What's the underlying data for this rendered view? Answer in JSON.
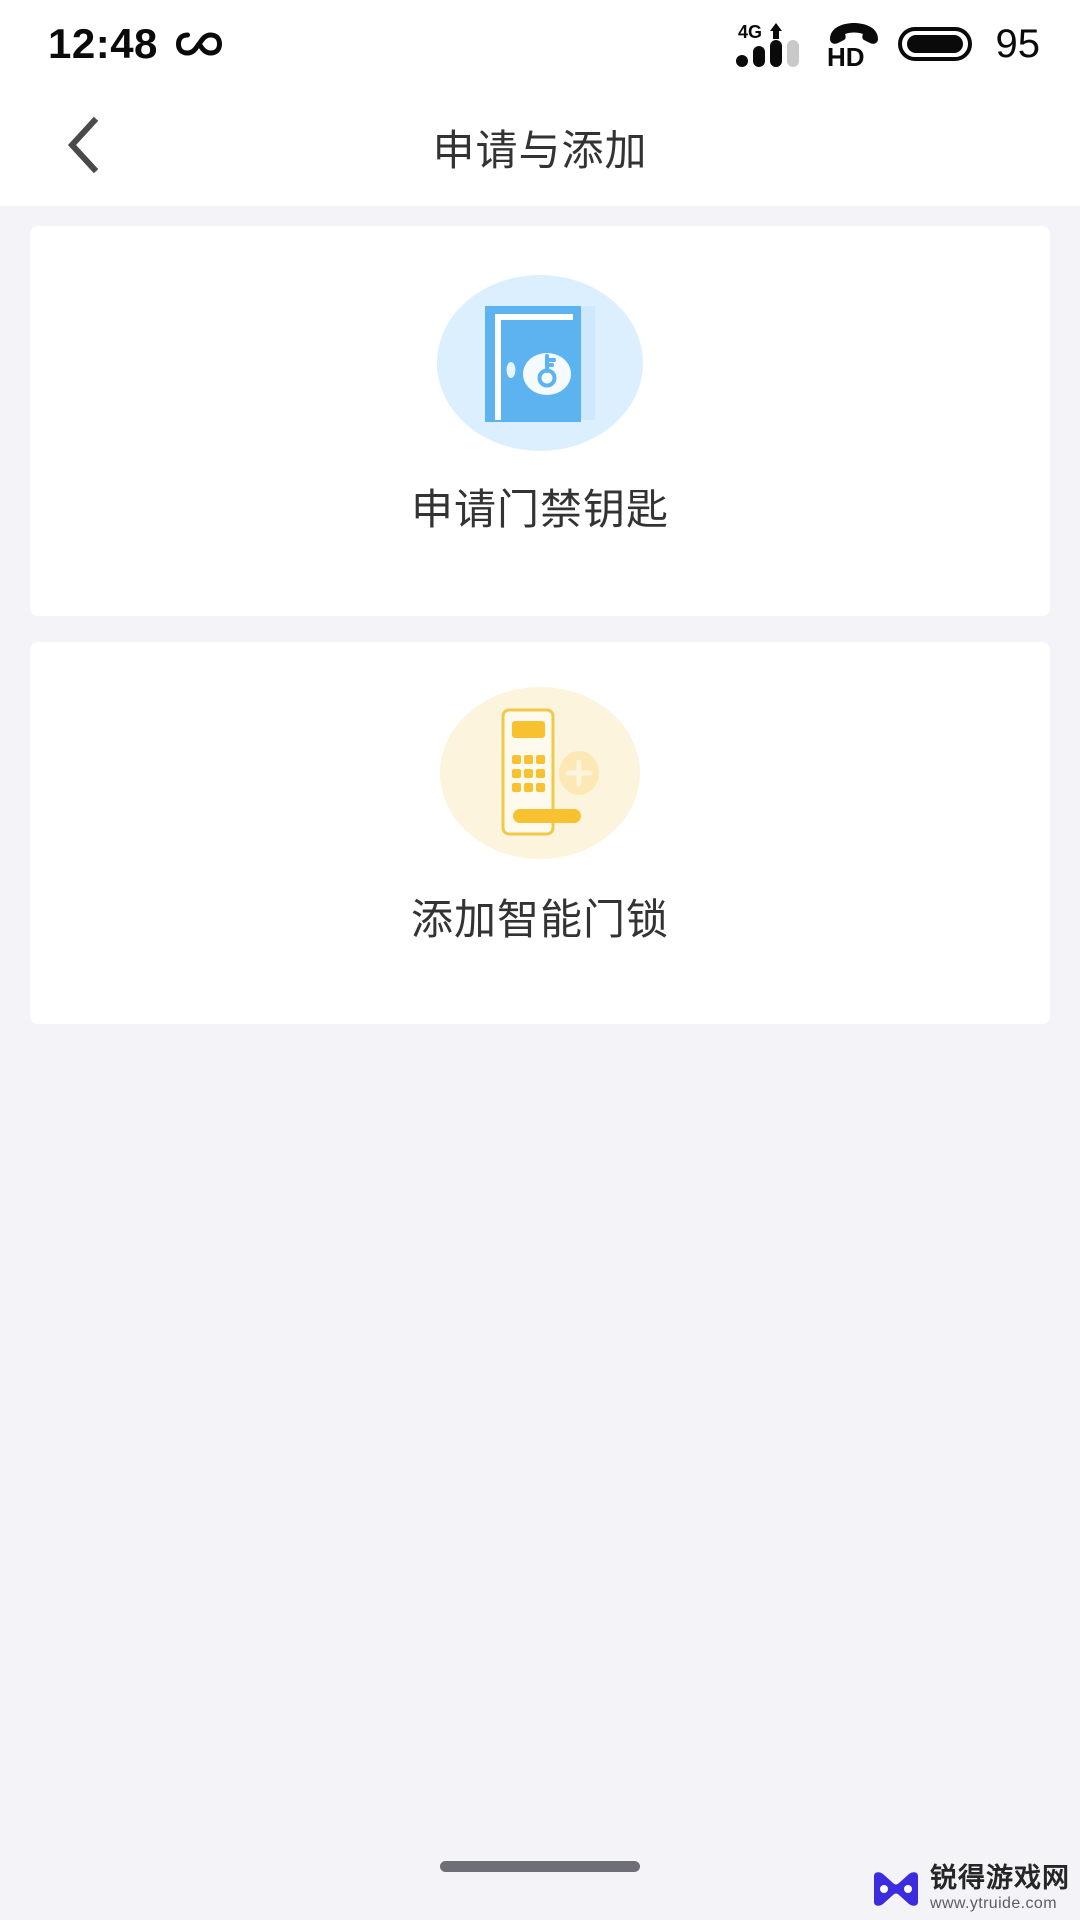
{
  "status_bar": {
    "time": "12:48",
    "infinity_icon": "infinity-icon",
    "network_label": "4G",
    "hd_label": "HD",
    "battery_percent": "95"
  },
  "nav": {
    "back_icon": "chevron-left-icon",
    "title": "申请与添加"
  },
  "cards": [
    {
      "id": "apply-access-key",
      "icon": "door-key-icon",
      "label": "申请门禁钥匙",
      "circle_color": "#dceeff",
      "accent_color": "#5cb3f0"
    },
    {
      "id": "add-smart-lock",
      "icon": "smart-lock-icon",
      "label": "添加智能门锁",
      "circle_color": "#fdf3dd",
      "accent_color": "#f6c343"
    }
  ],
  "home_indicator": {
    "label": "home-indicator"
  },
  "watermark": {
    "name": "锐得游戏网",
    "url": "www.ytruide.com",
    "logo_color": "#3322dd"
  },
  "colors": {
    "page_background": "#f4f4f8",
    "card_background": "#ffffff",
    "title_text": "#333333"
  }
}
